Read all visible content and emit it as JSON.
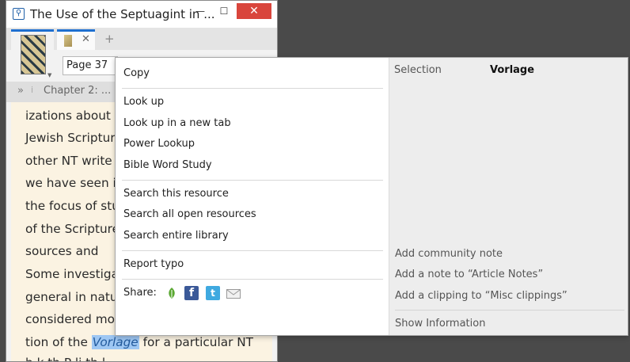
{
  "window": {
    "title": "The Use of the Septuagint in ...",
    "minimize_label": "—",
    "maximize_label": "☐",
    "close_label": "✕"
  },
  "tabs": {
    "close_label": "✕",
    "add_label": "+"
  },
  "toolbar": {
    "page_value": "Page 37",
    "chevron_label": "»",
    "divider_label": "i",
    "chapter_label": "Chapter 2: ..."
  },
  "document": {
    "lines": [
      "izations  about",
      "Jewish  Scriptur",
      "other  NT  write",
      "we  have  seen  i",
      "the  focus  of  stu",
      "of  the  Scripture",
      "sources    and",
      "Some  investiga",
      "general  in  natu",
      "considered  mor"
    ],
    "last_line_before": "tion of the ",
    "highlight": "Vorlage",
    "last_line_after": " for a particular NT",
    "partial_line": "b  k     th  P  li         th   l"
  },
  "context_menu": {
    "copy": "Copy",
    "lookup": "Look up",
    "lookup_new_tab": "Look up in a new tab",
    "power_lookup": "Power Lookup",
    "bible_word_study": "Bible Word Study",
    "search_resource": "Search this resource",
    "search_open": "Search all open resources",
    "search_library": "Search entire library",
    "report_typo": "Report typo",
    "share_label": "Share:",
    "facebook_glyph": "f",
    "twitter_glyph": "t",
    "selection_header": "Selection",
    "selection_value": "Vorlage",
    "add_community_note": "Add community note",
    "add_note": "Add a note to “Article Notes”",
    "add_clipping": "Add a clipping to “Misc clippings”",
    "show_information": "Show Information"
  },
  "colors": {
    "close_button": "#d9453c",
    "highlight": "#9ec7f3",
    "reader_background": "#fbf3e2",
    "tab_accent": "#1e6fd0"
  }
}
